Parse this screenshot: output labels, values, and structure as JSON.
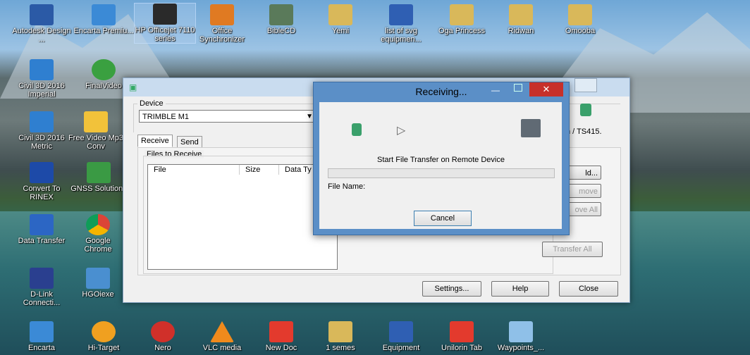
{
  "desktop": {
    "icons": [
      {
        "label": "Autodesk Design ..."
      },
      {
        "label": "Encarta Premiu..."
      },
      {
        "label": "HP Officejet 7110 series"
      },
      {
        "label": "Office Synchronizer"
      },
      {
        "label": "BibleCD"
      },
      {
        "label": "Yemi"
      },
      {
        "label": "list of svg equipmen..."
      },
      {
        "label": "Oga Princess"
      },
      {
        "label": "Ridwan"
      },
      {
        "label": "Omooba"
      },
      {
        "label": "Civil 3D 2016 Imperial"
      },
      {
        "label": "FinalVideo"
      },
      {
        "label": "Civil 3D 2016 Metric"
      },
      {
        "label": "Free Video Mp3 Conv"
      },
      {
        "label": "Convert To RINEX"
      },
      {
        "label": "GNSS Solutions"
      },
      {
        "label": "Data Transfer"
      },
      {
        "label": "Google Chrome"
      },
      {
        "label": "D-Link Connecti..."
      },
      {
        "label": "HGOiexe"
      },
      {
        "label": "Encarta"
      },
      {
        "label": "Hi-Target"
      },
      {
        "label": "Nero"
      },
      {
        "label": "VLC media"
      },
      {
        "label": "New Doc"
      },
      {
        "label": "1 semes"
      },
      {
        "label": "Equipment"
      },
      {
        "label": "Unilorin Tab"
      },
      {
        "label": "Waypoints_..."
      }
    ]
  },
  "main_window": {
    "device_label": "Device",
    "device_value": "TRIMBLE  M1",
    "tabs": [
      {
        "label": "Receive"
      },
      {
        "label": "Send"
      }
    ],
    "files_label": "Files to Receive",
    "columns": [
      {
        "label": "File"
      },
      {
        "label": "Size"
      },
      {
        "label": "Data Ty"
      }
    ],
    "instrument_text": "n / TS415.",
    "side_buttons": [
      {
        "label": "ld..."
      },
      {
        "label": "move"
      },
      {
        "label": "ove All"
      },
      {
        "label": "Transfer All"
      }
    ],
    "bottom_buttons": [
      {
        "label": "Settings..."
      },
      {
        "label": "Help"
      },
      {
        "label": "Close"
      }
    ]
  },
  "receiving_dialog": {
    "title": "Receiving...",
    "status": "Start File Transfer on Remote Device",
    "file_name_label": "File Name:",
    "cancel_label": "Cancel",
    "progress": 0
  }
}
